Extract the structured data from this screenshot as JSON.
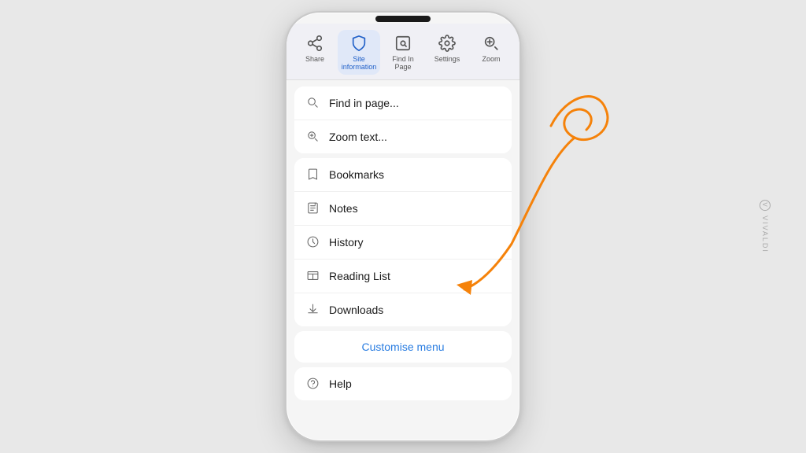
{
  "page": {
    "background_color": "#e8e8e8"
  },
  "vivaldi": {
    "label": "VIVALDI"
  },
  "toolbar": {
    "items": [
      {
        "id": "share",
        "label": "Share",
        "active": false
      },
      {
        "id": "site-information",
        "label": "Site information",
        "active": true
      },
      {
        "id": "find-in-page",
        "label": "Find In Page",
        "active": false
      },
      {
        "id": "settings",
        "label": "Settings",
        "active": false
      },
      {
        "id": "zoom",
        "label": "Zoom",
        "active": false
      }
    ]
  },
  "menu": {
    "groups": [
      {
        "id": "search-group",
        "items": [
          {
            "id": "find-in-page",
            "label": "Find in page...",
            "icon": "search"
          },
          {
            "id": "zoom-text",
            "label": "Zoom text...",
            "icon": "zoom"
          }
        ]
      },
      {
        "id": "nav-group",
        "items": [
          {
            "id": "bookmarks",
            "label": "Bookmarks",
            "icon": "bookmark"
          },
          {
            "id": "notes",
            "label": "Notes",
            "icon": "notes"
          },
          {
            "id": "history",
            "label": "History",
            "icon": "history"
          },
          {
            "id": "reading-list",
            "label": "Reading List",
            "icon": "reading-list"
          },
          {
            "id": "downloads",
            "label": "Downloads",
            "icon": "download"
          }
        ]
      }
    ],
    "customise_label": "Customise menu",
    "help_item": {
      "id": "help",
      "label": "Help",
      "icon": "help"
    }
  }
}
